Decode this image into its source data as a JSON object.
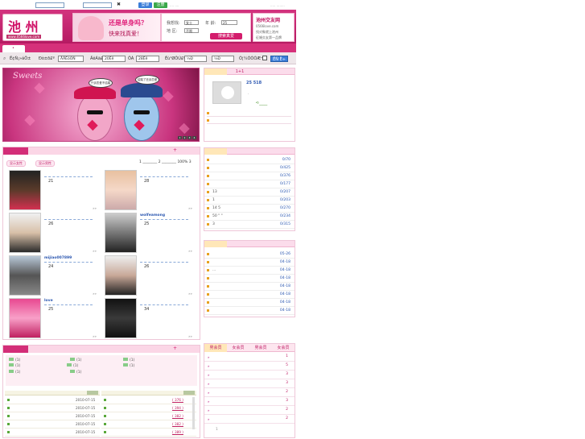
{
  "topbar": {
    "login_label": "登录",
    "register_label": "注册",
    "dots": ".... ....",
    "right_dots": "..... ........",
    "close_glyph": "✖"
  },
  "logo": {
    "big": "池 州",
    "sub": "www.0566love.com"
  },
  "banner": {
    "question": "还是单身吗？",
    "answer": "快来找真爱！"
  },
  "searchbox": {
    "gender_label": "我想找:",
    "gender_value": "女士",
    "age_label": "年  龄:",
    "age_value": "25",
    "area_label": "地  区:",
    "area_value": "不限",
    "go_label": "搜索真爱"
  },
  "ad2": {
    "title": "池州交友网",
    "line1": "0566love.com",
    "line2": "找对象就上池州",
    "line3": "征婚交友第一品牌"
  },
  "filter": {
    "label1": "Ë¢Ñ¡»áÔ±",
    "label2": "Ðò±ð£º",
    "sel1": "ÅÂËóÓÑ",
    "label3": "ÄêÁä£º",
    "sel2": "20Ëê",
    "label4": "ÖÁ",
    "sel3": "28Ëê",
    "label5": "Ëù¹ØÔÚ£º",
    "sel4": "½Ð",
    "sel5": "½Ð",
    "label6": "Õ¦¼ÒÕÕÆ¬",
    "go_label": "ËÑ Ë÷"
  },
  "bigphoto": {
    "signature": "Sweets",
    "bubble1": "只谈恋爱不结婚",
    "bubble2": "结婚了还谈恋爱",
    "dots": [
      "1",
      "2",
      "3",
      "4"
    ]
  },
  "profile_panel": {
    "tab_label": "1+1",
    "user_id": "25  518",
    "link_text": "➪____"
  },
  "members": {
    "tab1": "显示女性",
    "tab2": "显示男性",
    "pager": "1 ________ 2 ________ 100% 3",
    "items": [
      {
        "name": "",
        "age": "21",
        "more": "»»"
      },
      {
        "name": "",
        "age": "28",
        "more": "»»"
      },
      {
        "name": "",
        "age": "26",
        "more": "»»"
      },
      {
        "name": "wolfeamong",
        "age": "25",
        "more": "»»"
      },
      {
        "name": "mijiao007899",
        "age": "24",
        "more": "»»"
      },
      {
        "name": "",
        "age": "26",
        "more": "»»"
      },
      {
        "name": "love",
        "age": "25",
        "more": "»»"
      },
      {
        "name": "",
        "age": "34",
        "more": "»»"
      }
    ]
  },
  "rank1": [
    {
      "text": "",
      "value": "0/70"
    },
    {
      "text": "",
      "value": "0/425"
    },
    {
      "text": "",
      "value": "0/376"
    },
    {
      "text": "",
      "value": "0/177"
    },
    {
      "text": "13",
      "value": "0/207"
    },
    {
      "text": "1",
      "value": "0/203"
    },
    {
      "text": "14          5",
      "value": "0/270"
    },
    {
      "text": "50  \"    \"",
      "value": "0/234"
    },
    {
      "text": "3",
      "value": "0/315"
    }
  ],
  "rank2": [
    {
      "text": "",
      "value": "05-26"
    },
    {
      "text": "",
      "value": "04-18"
    },
    {
      "text": "...",
      "value": "04-18"
    },
    {
      "text": "",
      "value": "04-18"
    },
    {
      "text": "",
      "value": "04-18"
    },
    {
      "text": "",
      "value": "04-18"
    },
    {
      "text": "",
      "value": "04-18"
    },
    {
      "text": "",
      "value": "04-18"
    }
  ],
  "bottom": {
    "icons_text": [
      "(1)",
      "(1)",
      "(1)",
      "(1)",
      "(1)",
      "(1)",
      "(1)",
      "(1)"
    ],
    "left_rows": [
      "2010-07-15",
      "2010-07-15",
      "2010-07-15",
      "2010-07-15",
      "2010-07-15"
    ],
    "right_rows": [
      "( 376 )",
      "( 394 )",
      "( 382 )",
      "( 382 )",
      "( 389 )"
    ]
  },
  "ranking": {
    "tabs": [
      "男会员",
      "女会员",
      "男会员",
      "女会员"
    ],
    "values": [
      "1",
      "5",
      "3",
      "3",
      "2",
      "3",
      "2",
      "2"
    ],
    "footer": "1"
  }
}
